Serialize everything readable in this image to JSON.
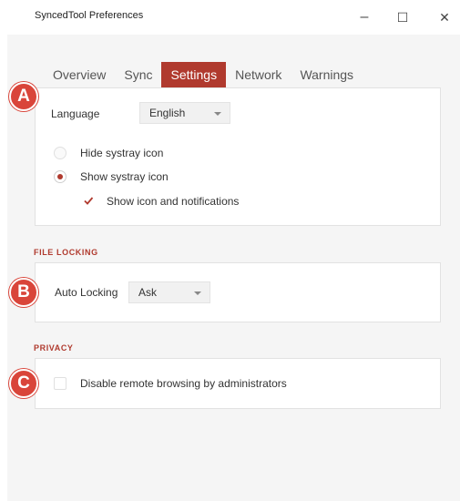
{
  "window": {
    "title": "SyncedTool Preferences",
    "minimize": "–",
    "maximize": "☐",
    "close": "✕"
  },
  "tabs": [
    {
      "label": "Overview"
    },
    {
      "label": "Sync"
    },
    {
      "label": "Settings",
      "active": true
    },
    {
      "label": "Network"
    },
    {
      "label": "Warnings"
    }
  ],
  "general": {
    "language_label": "Language",
    "language_value": "English",
    "hide_systray": "Hide systray icon",
    "show_systray": "Show systray icon",
    "show_icon_notifications": "Show icon and notifications"
  },
  "file_locking": {
    "heading": "FILE LOCKING",
    "auto_locking_label": "Auto Locking",
    "auto_locking_value": "Ask"
  },
  "privacy": {
    "heading": "PRIVACY",
    "disable_remote_browsing": "Disable remote browsing by administrators"
  },
  "markers": {
    "a": "A",
    "b": "B",
    "c": "C"
  },
  "colors": {
    "accent": "#b03a2e",
    "marker": "#d9453a",
    "window_bg": "#f5f5f5"
  }
}
